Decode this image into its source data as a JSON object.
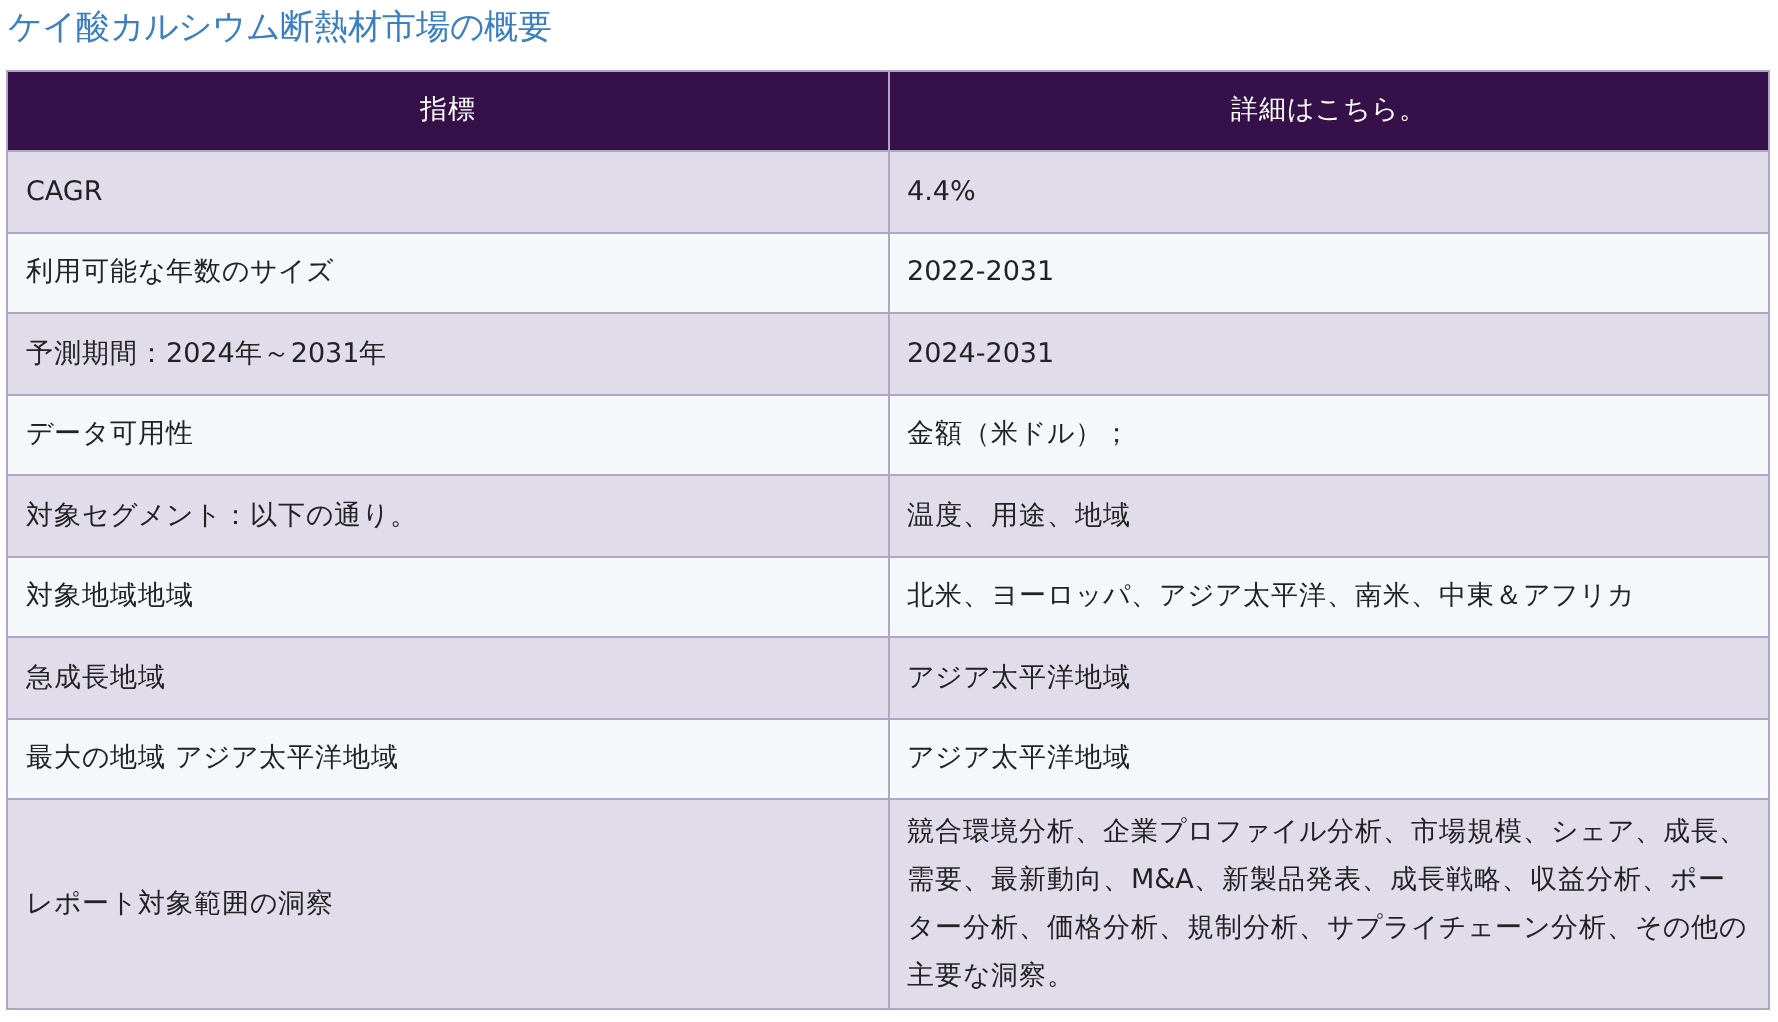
{
  "title": "ケイ酸カルシウム断熱材市場の概要",
  "table": {
    "columns": [
      "指標",
      "詳細はこちら。"
    ],
    "rows": [
      [
        "CAGR",
        "4.4%"
      ],
      [
        "利用可能な年数のサイズ",
        "2022-2031"
      ],
      [
        "予測期間：2024年～2031年",
        "2024-2031"
      ],
      [
        "データ可用性",
        "金額（米ドル）；"
      ],
      [
        "対象セグメント：以下の通り。",
        "温度、用途、地域"
      ],
      [
        "対象地域地域",
        "北米、ヨーロッパ、アジア太平洋、南米、中東＆アフリカ"
      ],
      [
        "急成長地域",
        "アジア太平洋地域"
      ],
      [
        "最大の地域 アジア太平洋地域",
        "アジア太平洋地域"
      ],
      [
        "レポート対象範囲の洞察",
        "競合環境分析、企業プロファイル分析、市場規模、シェア、成長、需要、最新動向、M&A、新製品発表、成長戦略、収益分析、ポーター分析、価格分析、規制分析、サプライチェーン分析、その他の主要な洞察。"
      ]
    ]
  }
}
